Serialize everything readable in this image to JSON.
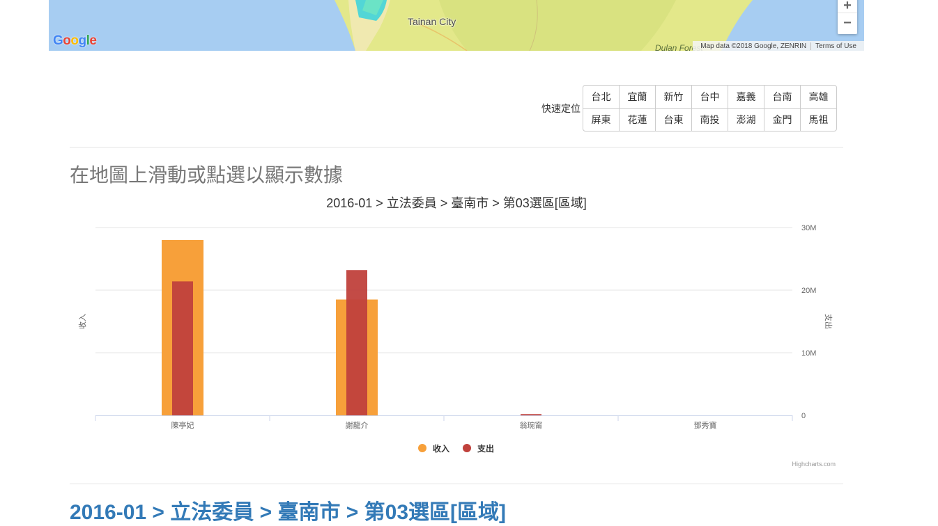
{
  "map": {
    "city_label": "Tainan City",
    "forest_label": "Dulan Forest",
    "logo_text": "Google",
    "attribution": "Map data ©2018 Google, ZENRIN",
    "terms": "Terms of Use",
    "zoom_in": "+",
    "zoom_out": "−"
  },
  "quick_locate": {
    "label": "快速定位",
    "rows": [
      [
        "台北",
        "宜蘭",
        "新竹",
        "台中",
        "嘉義",
        "台南",
        "高雄"
      ],
      [
        "屏東",
        "花蓮",
        "台東",
        "南投",
        "澎湖",
        "金門",
        "馬祖"
      ]
    ]
  },
  "prompt_title": "在地圖上滑動或點選以顯示數據",
  "chart_data": {
    "type": "bar",
    "title": "2016-01 > 立法委員 > 臺南市 > 第03選區[區域]",
    "categories": [
      "陳亭妃",
      "謝龍介",
      "翁琬甯",
      "鄧秀寶"
    ],
    "series": [
      {
        "name": "收入",
        "color": "#f7a03a",
        "values": [
          28.0,
          18.5,
          0,
          0
        ]
      },
      {
        "name": "支出",
        "color": "#c0413c",
        "values": [
          21.4,
          23.2,
          0.2,
          0
        ]
      }
    ],
    "ylabel_left": "收入",
    "ylabel_right": "支出",
    "ylim": [
      0,
      30
    ],
    "ytick_labels": [
      "0",
      "10M",
      "20M",
      "30M"
    ],
    "grid": true,
    "legend_position": "bottom-center",
    "credits": "Highcharts.com"
  },
  "sub_heading": "2016-01 > 立法委員 > 臺南市 > 第03選區[區域]"
}
